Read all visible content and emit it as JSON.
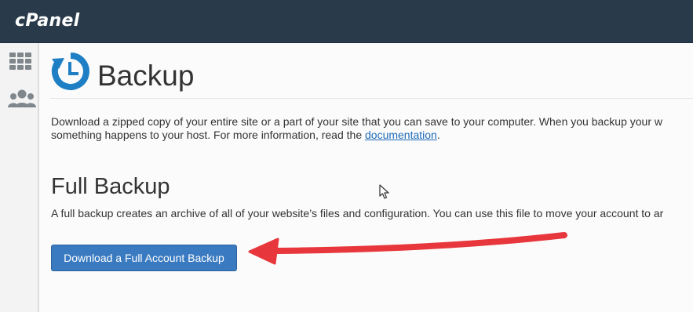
{
  "app": {
    "logo_text": "cPanel"
  },
  "sidebar": {
    "items": [
      {
        "icon": "grid-icon"
      },
      {
        "icon": "users-icon"
      }
    ]
  },
  "page": {
    "title": "Backup",
    "icon": "backup-clock-icon",
    "intro_text": "Download a zipped copy of your entire site or a part of your site that you can save to your computer. When you backup your w",
    "intro_line2_prefix": "something happens to your host. For more information, read the ",
    "documentation_link": "documentation",
    "intro_line2_suffix": "."
  },
  "full_backup": {
    "heading": "Full Backup",
    "description": "A full backup creates an archive of all of your website’s files and configuration. You can use this file to move your account to ar",
    "button_label": "Download a Full Account Backup"
  },
  "colors": {
    "topbar": "#293a4a",
    "accent_blue": "#3a7ac0",
    "link": "#1e6bb8",
    "annotation_arrow": "#e8373c"
  }
}
